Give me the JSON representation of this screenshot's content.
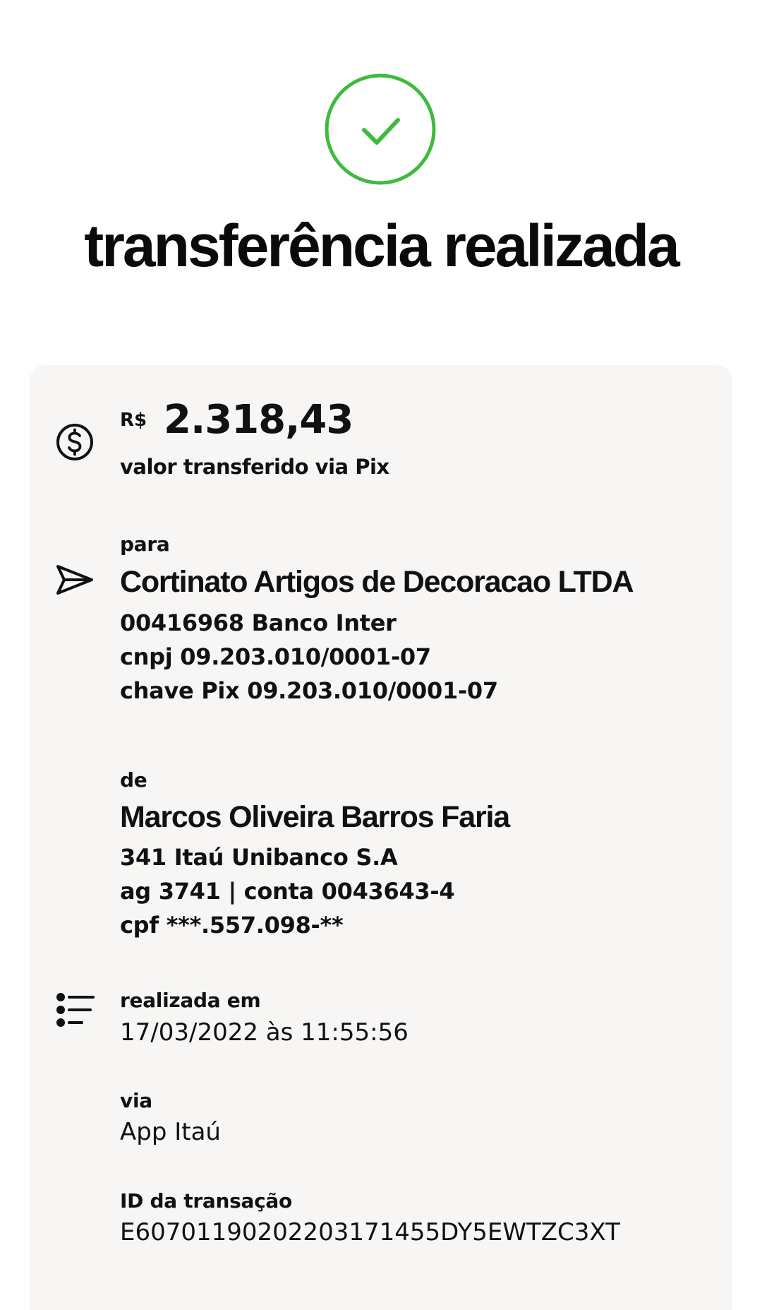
{
  "header": {
    "title": "transferência realizada",
    "success_color": "#3dbb3d"
  },
  "amount": {
    "currency": "R$",
    "value": "2.318,43",
    "label": "valor transferido via Pix",
    "icon": "dollar-circle-icon"
  },
  "recipient": {
    "label": "para",
    "icon": "send-icon",
    "name": "Cortinato Artigos de Decoracao LTDA",
    "bank": "00416968 Banco Inter",
    "cnpj": "cnpj 09.203.010/0001-07",
    "pix_key": "chave Pix 09.203.010/0001-07"
  },
  "sender": {
    "label": "de",
    "name": "Marcos Oliveira Barros Faria",
    "bank": "341 Itaú Unibanco S.A",
    "account": "ag 3741 | conta 0043643-4",
    "cpf": "cpf ***.557.098-**"
  },
  "details": {
    "icon": "list-icon",
    "date_label": "realizada em",
    "date_value": "17/03/2022 às 11:55:56",
    "via_label": "via",
    "via_value": "App Itaú",
    "id_label": "ID da transação",
    "id_value": "E60701190202203171455DY5EWTZC3XT"
  },
  "colors": {
    "card_background": "#f8f6f4",
    "text": "#111111"
  }
}
